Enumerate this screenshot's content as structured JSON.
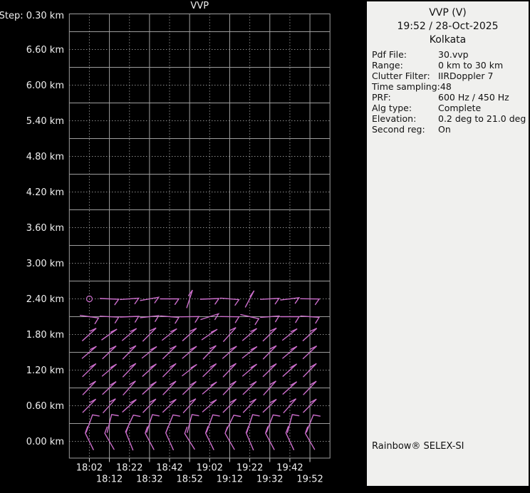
{
  "window": {
    "bg": "#000000"
  },
  "chart_data": {
    "type": "wind-barb-profile",
    "title": "VVP",
    "step_label": "Step: 0.30 km",
    "x_ticks": [
      "18:02",
      "18:12",
      "18:22",
      "18:32",
      "18:42",
      "18:52",
      "19:02",
      "19:12",
      "19:22",
      "19:32",
      "19:42",
      "19:52"
    ],
    "y_ticks": [
      "6.60 km",
      "6.00 km",
      "5.40 km",
      "4.80 km",
      "4.20 km",
      "3.60 km",
      "3.00 km",
      "2.40 km",
      "1.80 km",
      "1.20 km",
      "0.60 km",
      "0.00 km"
    ],
    "y_axis_step_km": 0.3,
    "barb_heights_km": [
      2.4,
      2.1,
      1.8,
      1.5,
      1.2,
      0.9,
      0.6,
      0.3,
      0.0
    ],
    "calm_cells": [
      {
        "row": 0,
        "col": 0
      }
    ],
    "barb_rows": [
      {
        "height_km": 2.4,
        "feather_dir": 215,
        "dirs": [
          null,
          92,
          86,
          80,
          90,
          18,
          88,
          95,
          28,
          87,
          83,
          91
        ]
      },
      {
        "height_km": 2.1,
        "feather_dir": 212,
        "dirs": [
          98,
          93,
          88,
          84,
          95,
          89,
          72,
          91,
          103,
          86,
          90,
          94
        ]
      },
      {
        "height_km": 1.8,
        "feather_dir": 245,
        "dirs": [
          48,
          55,
          50,
          45,
          52,
          48,
          56,
          42,
          50,
          46,
          52,
          48
        ]
      },
      {
        "height_km": 1.5,
        "feather_dir": 243,
        "dirs": [
          50,
          47,
          45,
          52,
          46,
          50,
          44,
          49,
          52,
          45,
          50,
          47
        ]
      },
      {
        "height_km": 1.2,
        "feather_dir": 240,
        "dirs": [
          46,
          50,
          44,
          48,
          45,
          52,
          46,
          44,
          50,
          46,
          48,
          45
        ]
      },
      {
        "height_km": 0.9,
        "feather_dir": 240,
        "dirs": [
          44,
          47,
          42,
          48,
          44,
          46,
          50,
          44,
          46,
          42,
          48,
          44
        ]
      },
      {
        "height_km": 0.6,
        "feather_dir": 242,
        "dirs": [
          45,
          42,
          48,
          44,
          46,
          42,
          49,
          45,
          44,
          46,
          42,
          45
        ]
      },
      {
        "height_km": 0.3,
        "feather_dir": 100,
        "dirs": [
          20,
          14,
          25,
          18,
          22,
          15,
          20,
          26,
          18,
          21,
          15,
          22
        ]
      },
      {
        "height_km": 0.0,
        "feather_dir": 20,
        "dirs": [
          334,
          330,
          338,
          332,
          336,
          328,
          334,
          330,
          337,
          332,
          335,
          330
        ]
      }
    ],
    "colors": {
      "barb": "#cc6ecc",
      "grid_solid": "#9e9e9e",
      "grid_dotted": "#cccccc",
      "frame": "#9e9e9e",
      "tick": "#d8d8d8",
      "text": "#f0f0f0",
      "bg": "#000000"
    }
  },
  "info_panel": {
    "bg": "#f0f0ee",
    "title": "VVP (V)",
    "datetime": "19:52 / 28-Oct-2025",
    "site": "Kolkata",
    "rows": [
      {
        "label": "Pdf File:",
        "value": "30.vvp"
      },
      {
        "label": "Range:",
        "value": "0 km to 30 km"
      },
      {
        "label": "Clutter Filter:",
        "value": "IIRDoppler 7"
      },
      {
        "label": "Time sampling:",
        "value": "48"
      },
      {
        "label": "PRF:",
        "value": "600 Hz / 450 Hz"
      },
      {
        "label": "Alg type:",
        "value": "Complete"
      },
      {
        "label": "Elevation:",
        "value": "0.2 deg to 21.0 deg"
      },
      {
        "label": "Second reg:",
        "value": "On"
      }
    ],
    "brand": "Rainbow® SELEX-SI"
  }
}
